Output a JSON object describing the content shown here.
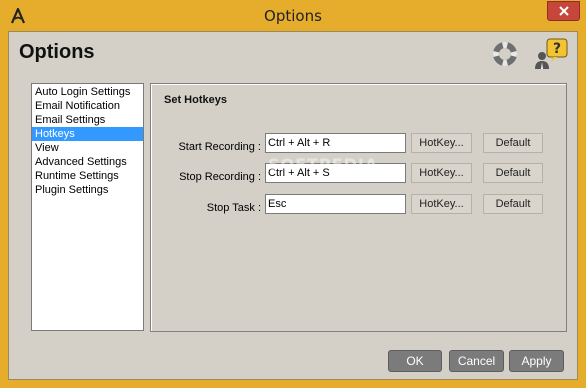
{
  "window": {
    "title": "Options",
    "close_icon": "close-icon",
    "app_icon": "app-logo-icon"
  },
  "header": {
    "title": "Options",
    "support_icon": "lifebuoy-icon",
    "help_icon": "user-help-icon"
  },
  "sidebar": {
    "items": [
      {
        "label": "Auto Login Settings",
        "selected": false
      },
      {
        "label": "Email Notification",
        "selected": false
      },
      {
        "label": "Email Settings",
        "selected": false
      },
      {
        "label": "Hotkeys",
        "selected": true
      },
      {
        "label": "View",
        "selected": false
      },
      {
        "label": "Advanced Settings",
        "selected": false
      },
      {
        "label": "Runtime Settings",
        "selected": false
      },
      {
        "label": "Plugin Settings",
        "selected": false
      }
    ]
  },
  "panel": {
    "title": "Set Hotkeys",
    "rows": [
      {
        "label": "Start Recording :",
        "value": "Ctrl + Alt + R",
        "hotkey_button": "HotKey...",
        "default_button": "Default"
      },
      {
        "label": "Stop Recording :",
        "value": "Ctrl + Alt + S",
        "hotkey_button": "HotKey...",
        "default_button": "Default"
      },
      {
        "label": "Stop Task :",
        "value": "Esc",
        "hotkey_button": "HotKey...",
        "default_button": "Default"
      }
    ]
  },
  "watermark": "SOFTPEDIA",
  "footer": {
    "ok": "OK",
    "cancel": "Cancel",
    "apply": "Apply"
  },
  "colors": {
    "frame": "#e6ad2c",
    "client": "#d4d0c8",
    "selection": "#3399ff",
    "close": "#c7463b",
    "footer_button": "#7b7b7b"
  }
}
